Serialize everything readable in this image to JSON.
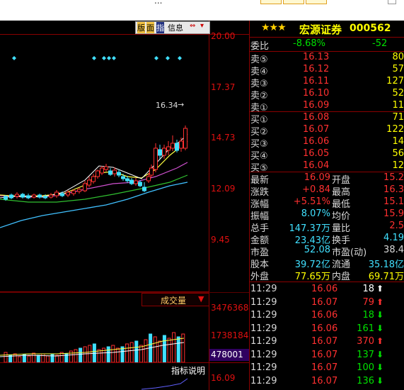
{
  "window": {
    "title_fragment": "...",
    "tabs": [
      "...",
      "...",
      "..."
    ]
  },
  "chart_toolbar": {
    "icons": [
      "版",
      "面",
      "指"
    ],
    "info_label": "信息"
  },
  "price_axis": [
    "20.00",
    "17.37",
    "14.73",
    "12.09",
    "9.45"
  ],
  "peak_label": "16.34",
  "volume_axis": [
    "3476368",
    "1738184"
  ],
  "volume_current": "478001",
  "volume_dropdown": "成交量",
  "indicator_button": "指标说明",
  "indicator_axis": "16.09",
  "stock": {
    "stars": "★★★",
    "name": "宏源证券",
    "code": "000562"
  },
  "order_book": {
    "ratio_label": "委比",
    "ratio": "-8.68%",
    "ratio_right": "-52",
    "asks": [
      {
        "label": "卖⑤",
        "price": "16.13",
        "vol": "80"
      },
      {
        "label": "卖④",
        "price": "16.12",
        "vol": "57"
      },
      {
        "label": "卖③",
        "price": "16.11",
        "vol": "127"
      },
      {
        "label": "卖②",
        "price": "16.10",
        "vol": "52"
      },
      {
        "label": "卖①",
        "price": "16.09",
        "vol": "11"
      }
    ],
    "bids": [
      {
        "label": "买①",
        "price": "16.08",
        "vol": "71"
      },
      {
        "label": "买②",
        "price": "16.07",
        "vol": "122"
      },
      {
        "label": "买③",
        "price": "16.06",
        "vol": "14"
      },
      {
        "label": "买④",
        "price": "16.05",
        "vol": "56"
      },
      {
        "label": "买⑤",
        "price": "16.04",
        "vol": "12"
      }
    ]
  },
  "stats": [
    {
      "l1": "最新",
      "v1": "16.09",
      "l2": "开盘",
      "v2": "15.2"
    },
    {
      "l1": "涨跌",
      "v1": "+0.84",
      "l2": "最高",
      "v2": "16.3"
    },
    {
      "l1": "涨幅",
      "v1": "+5.51%",
      "l2": "最低",
      "v2": "15.1"
    },
    {
      "l1": "振幅",
      "v1": "8.07%",
      "l2": "均价",
      "v2": "15.9"
    },
    {
      "l1": "总手",
      "v1": "147.37万",
      "l2": "量比",
      "v2": "2.5"
    },
    {
      "l1": "金额",
      "v1": "23.43亿",
      "l2": "换手",
      "v2": "4.19"
    },
    {
      "l1": "市盈",
      "v1": "52.08",
      "l2": "市盈(动)",
      "v2": "38.4"
    },
    {
      "l1": "股本",
      "v1": "39.72亿",
      "l2": "流通",
      "v2": "35.18亿"
    },
    {
      "l1": "外盘",
      "v1": "77.65万",
      "l2": "内盘",
      "v2": "69.71万"
    }
  ],
  "trades": [
    {
      "time": "11:29",
      "price": "16.06",
      "vol": "18",
      "dir": "up"
    },
    {
      "time": "11:29",
      "price": "16.07",
      "vol": "79",
      "dir": "up"
    },
    {
      "time": "11:29",
      "price": "16.06",
      "vol": "18",
      "dir": "down"
    },
    {
      "time": "11:29",
      "price": "16.06",
      "vol": "161",
      "dir": "down"
    },
    {
      "time": "11:29",
      "price": "16.07",
      "vol": "370",
      "dir": "up"
    },
    {
      "time": "11:29",
      "price": "16.07",
      "vol": "137",
      "dir": "down"
    },
    {
      "time": "11:29",
      "price": "16.07",
      "vol": "100",
      "dir": "down"
    },
    {
      "time": "11:29",
      "price": "16.07",
      "vol": "136",
      "dir": "down"
    }
  ],
  "colors": {
    "up": "#ff3030",
    "down": "#00e000",
    "label": "#d8d8d8",
    "price": "#ffff00",
    "cyan": "#40e0ff",
    "grid": "#8a0000"
  }
}
